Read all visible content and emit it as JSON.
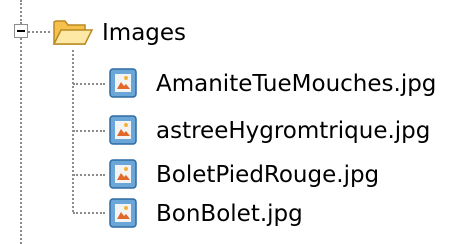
{
  "tree": {
    "folder": {
      "label": "Images",
      "expanded": true,
      "icon": "open-folder-icon"
    },
    "files": [
      {
        "label": "AmaniteTueMouches.jpg",
        "icon": "jpg-image-file-icon"
      },
      {
        "label": "astreeHygromtrique.jpg",
        "icon": "jpg-image-file-icon"
      },
      {
        "label": "BoletPiedRouge.jpg",
        "icon": "jpg-image-file-icon"
      },
      {
        "label": "BonBolet.jpg",
        "icon": "jpg-image-file-icon"
      }
    ]
  }
}
